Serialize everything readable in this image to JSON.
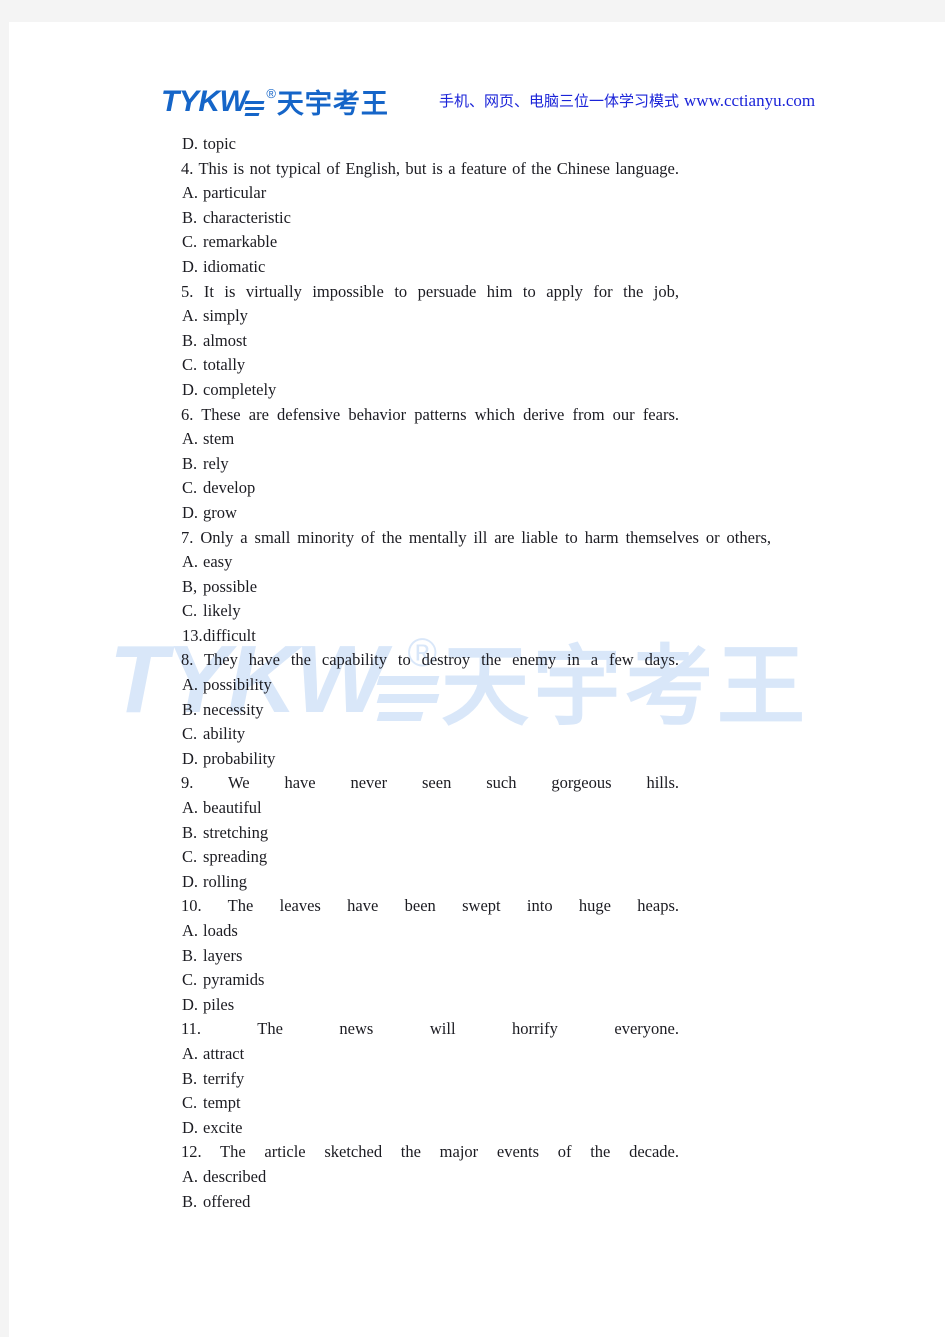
{
  "header": {
    "logo": {
      "latin": "TYKW",
      "registered": "®",
      "chinese": "天宇考王"
    },
    "tagline_cn": "手机、网页、电脑三位一体学习模式",
    "url": "www.cctianyu.com",
    "brand_color": "#1565c8",
    "tagline_color": "#1a23d8"
  },
  "watermark": {
    "latin": "TYKW",
    "registered": "®",
    "chinese": "天宇考王",
    "color": "#d9e7f9"
  },
  "document": {
    "lines": [
      {
        "type": "option",
        "label": "D.",
        "text": "topic"
      },
      {
        "type": "question",
        "text": "4. This is not typical of English, but is a feature of the Chinese language."
      },
      {
        "type": "option",
        "label": "A.",
        "text": "particular"
      },
      {
        "type": "option",
        "label": "B.",
        "text": "characteristic"
      },
      {
        "type": "option",
        "label": "C.",
        "text": "remarkable"
      },
      {
        "type": "option",
        "label": "D.",
        "text": "idiomatic"
      },
      {
        "type": "question",
        "text": "5. It is virtually impossible to persuade him to apply for the job,"
      },
      {
        "type": "option",
        "label": "A.",
        "text": "simply"
      },
      {
        "type": "option",
        "label": "B.",
        "text": "almost"
      },
      {
        "type": "option",
        "label": "C.",
        "text": "totally"
      },
      {
        "type": "option",
        "label": "D.",
        "text": "completely"
      },
      {
        "type": "question",
        "text": "6. These are defensive behavior patterns which derive from our fears."
      },
      {
        "type": "option",
        "label": "A.",
        "text": "stem"
      },
      {
        "type": "option",
        "label": "B.",
        "text": "rely"
      },
      {
        "type": "option",
        "label": "C.",
        "text": "develop"
      },
      {
        "type": "option",
        "label": "D.",
        "text": "grow"
      },
      {
        "type": "question",
        "wide": true,
        "text": "7. Only a small minority of the mentally ill are liable to harm themselves or others,"
      },
      {
        "type": "option",
        "label": "A.",
        "text": "easy"
      },
      {
        "type": "option",
        "label": "B,",
        "text": "possible"
      },
      {
        "type": "option",
        "label": "C.",
        "text": "likely"
      },
      {
        "type": "option",
        "label": "13.",
        "text": "difficult"
      },
      {
        "type": "question",
        "text": "8. They have the capability to destroy the enemy in a few days."
      },
      {
        "type": "option",
        "label": "A.",
        "text": "possibility"
      },
      {
        "type": "option",
        "label": "B.",
        "text": "necessity"
      },
      {
        "type": "option",
        "label": "C.",
        "text": "ability"
      },
      {
        "type": "option",
        "label": "D.",
        "text": "probability"
      },
      {
        "type": "question",
        "text": "9. We have never seen such gorgeous hills."
      },
      {
        "type": "option",
        "label": "A.",
        "text": "beautiful"
      },
      {
        "type": "option",
        "label": "B.",
        "text": "stretching"
      },
      {
        "type": "option",
        "label": "C.",
        "text": "spreading"
      },
      {
        "type": "option",
        "label": "D.",
        "text": "rolling"
      },
      {
        "type": "question",
        "text": "10. The leaves have been swept into huge heaps."
      },
      {
        "type": "option",
        "label": "A.",
        "text": "loads"
      },
      {
        "type": "option",
        "label": "B.",
        "text": "layers"
      },
      {
        "type": "option",
        "label": "C.",
        "text": "pyramids"
      },
      {
        "type": "option",
        "label": "D.",
        "text": "piles"
      },
      {
        "type": "question",
        "text": "11. The news will horrify everyone."
      },
      {
        "type": "option",
        "label": "A.",
        "text": "attract"
      },
      {
        "type": "option",
        "label": "B.",
        "text": "terrify"
      },
      {
        "type": "option",
        "label": "C.",
        "text": "tempt"
      },
      {
        "type": "option",
        "label": "D.",
        "text": "excite"
      },
      {
        "type": "question",
        "text": "12. The article sketched the major events of the decade."
      },
      {
        "type": "option",
        "label": "A.",
        "text": "described"
      },
      {
        "type": "option",
        "label": "B.",
        "text": "offered"
      }
    ]
  }
}
